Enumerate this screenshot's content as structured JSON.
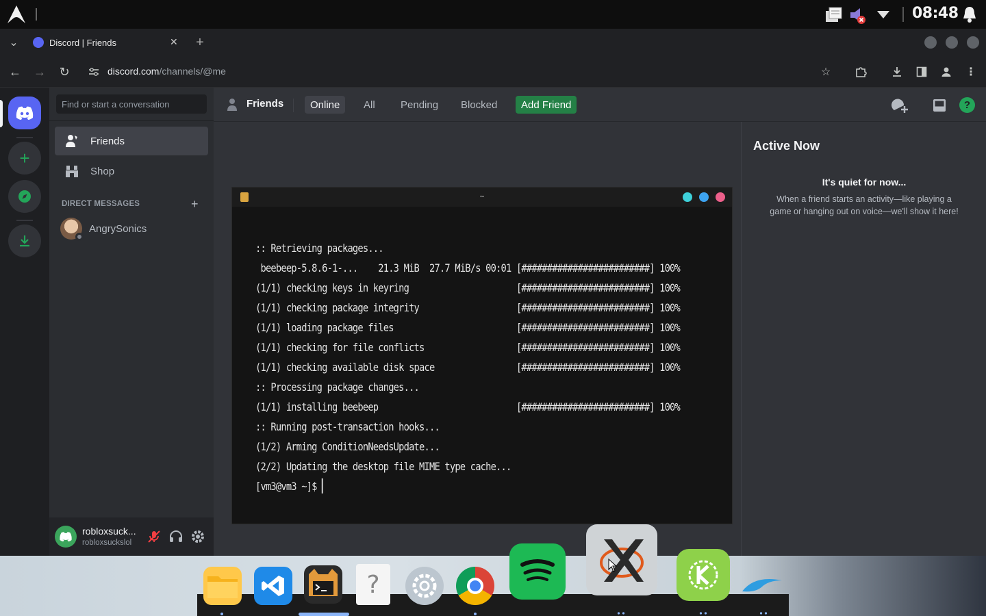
{
  "system": {
    "clock": "08:48"
  },
  "browser": {
    "tab_title": "Discord | Friends",
    "url_host": "discord.com",
    "url_path": "/channels/@me"
  },
  "discord": {
    "search_placeholder": "Find or start a conversation",
    "nav": [
      {
        "label": "Friends",
        "icon": "friends-icon"
      },
      {
        "label": "Shop",
        "icon": "shop-icon"
      }
    ],
    "dm_header": "DIRECT MESSAGES",
    "dms": [
      {
        "name": "AngrySonics"
      }
    ],
    "user": {
      "display_name": "robloxsuck...",
      "username": "robloxsuckslol"
    },
    "header": {
      "title": "Friends",
      "tabs": [
        "Online",
        "All",
        "Pending",
        "Blocked"
      ],
      "add_friend": "Add Friend"
    },
    "active_now": {
      "title": "Active Now",
      "empty_title": "It's quiet for now...",
      "empty_body_line1": "When a friend starts an activity—like playing a",
      "empty_body_line2": "game or hanging out on voice—we'll show it here!"
    }
  },
  "terminal": {
    "title": "~",
    "lines": [
      ":: Retrieving packages...",
      " beebeep-5.8.6-1-...    21.3 MiB  27.7 MiB/s 00:01 [#########################] 100%",
      "(1/1) checking keys in keyring                     [#########################] 100%",
      "(1/1) checking package integrity                   [#########################] 100%",
      "(1/1) loading package files                        [#########################] 100%",
      "(1/1) checking for file conflicts                  [#########################] 100%",
      "(1/1) checking available disk space                [#########################] 100%",
      ":: Processing package changes...",
      "(1/1) installing beebeep                           [#########################] 100%",
      ":: Running post-transaction hooks...",
      "(1/2) Arming ConditionNeedsUpdate...",
      "(2/2) Updating the desktop file MIME type cache...",
      "[vm3@vm3 ~]$ "
    ]
  },
  "colors": {
    "discord_blurple": "#5865f2",
    "discord_green": "#23a559",
    "add_friend_bg": "#248046"
  }
}
